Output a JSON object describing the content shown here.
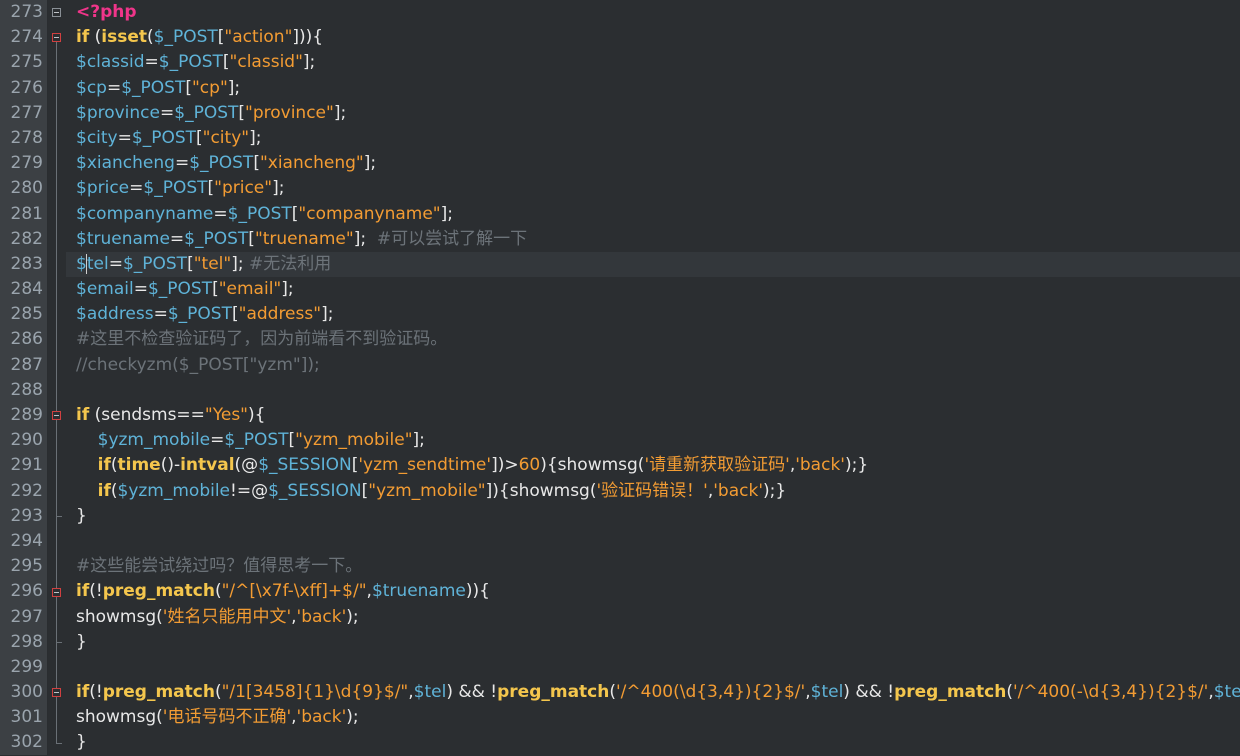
{
  "editor": {
    "line_numbers": [
      "273",
      "274",
      "275",
      "276",
      "277",
      "278",
      "279",
      "280",
      "281",
      "282",
      "283",
      "284",
      "285",
      "286",
      "287",
      "288",
      "289",
      "290",
      "291",
      "292",
      "293",
      "294",
      "295",
      "296",
      "297",
      "298",
      "299",
      "300",
      "301",
      "302"
    ],
    "lines": [
      [
        [
          "php",
          "<?php"
        ]
      ],
      [
        [
          "kw",
          "if"
        ],
        [
          "op",
          " ("
        ],
        [
          "fn",
          "isset"
        ],
        [
          "op",
          "("
        ],
        [
          "var",
          "$_POST"
        ],
        [
          "op",
          "["
        ],
        [
          "str",
          "\"action\""
        ],
        [
          "op",
          "])){"
        ]
      ],
      [
        [
          "var",
          "$classid"
        ],
        [
          "op",
          "="
        ],
        [
          "var",
          "$_POST"
        ],
        [
          "op",
          "["
        ],
        [
          "str",
          "\"classid\""
        ],
        [
          "op",
          "];"
        ]
      ],
      [
        [
          "var",
          "$cp"
        ],
        [
          "op",
          "="
        ],
        [
          "var",
          "$_POST"
        ],
        [
          "op",
          "["
        ],
        [
          "str",
          "\"cp\""
        ],
        [
          "op",
          "];"
        ]
      ],
      [
        [
          "var",
          "$province"
        ],
        [
          "op",
          "="
        ],
        [
          "var",
          "$_POST"
        ],
        [
          "op",
          "["
        ],
        [
          "str",
          "\"province\""
        ],
        [
          "op",
          "];"
        ]
      ],
      [
        [
          "var",
          "$city"
        ],
        [
          "op",
          "="
        ],
        [
          "var",
          "$_POST"
        ],
        [
          "op",
          "["
        ],
        [
          "str",
          "\"city\""
        ],
        [
          "op",
          "];"
        ]
      ],
      [
        [
          "var",
          "$xiancheng"
        ],
        [
          "op",
          "="
        ],
        [
          "var",
          "$_POST"
        ],
        [
          "op",
          "["
        ],
        [
          "str",
          "\"xiancheng\""
        ],
        [
          "op",
          "];"
        ]
      ],
      [
        [
          "var",
          "$price"
        ],
        [
          "op",
          "="
        ],
        [
          "var",
          "$_POST"
        ],
        [
          "op",
          "["
        ],
        [
          "str",
          "\"price\""
        ],
        [
          "op",
          "];"
        ]
      ],
      [
        [
          "var",
          "$companyname"
        ],
        [
          "op",
          "="
        ],
        [
          "var",
          "$_POST"
        ],
        [
          "op",
          "["
        ],
        [
          "str",
          "\"companyname\""
        ],
        [
          "op",
          "];"
        ]
      ],
      [
        [
          "var",
          "$truename"
        ],
        [
          "op",
          "="
        ],
        [
          "var",
          "$_POST"
        ],
        [
          "op",
          "["
        ],
        [
          "str",
          "\"truename\""
        ],
        [
          "op",
          "];  "
        ],
        [
          "cmt",
          "#可以尝试了解一下"
        ]
      ],
      [
        [
          "var",
          "$tel"
        ],
        [
          "op",
          "="
        ],
        [
          "var",
          "$_POST"
        ],
        [
          "op",
          "["
        ],
        [
          "str",
          "\"tel\""
        ],
        [
          "op",
          "]; "
        ],
        [
          "cmt",
          "#无法利用"
        ]
      ],
      [
        [
          "var",
          "$email"
        ],
        [
          "op",
          "="
        ],
        [
          "var",
          "$_POST"
        ],
        [
          "op",
          "["
        ],
        [
          "str",
          "\"email\""
        ],
        [
          "op",
          "];"
        ]
      ],
      [
        [
          "var",
          "$address"
        ],
        [
          "op",
          "="
        ],
        [
          "var",
          "$_POST"
        ],
        [
          "op",
          "["
        ],
        [
          "str",
          "\"address\""
        ],
        [
          "op",
          "];"
        ]
      ],
      [
        [
          "cmt",
          "#这里不检查验证码了，因为前端看不到验证码。"
        ]
      ],
      [
        [
          "cmt",
          "//checkyzm($_POST[\"yzm\"]);"
        ]
      ],
      [],
      [
        [
          "kw",
          "if"
        ],
        [
          "op",
          " (sendsms=="
        ],
        [
          "str",
          "\"Yes\""
        ],
        [
          "op",
          "){"
        ]
      ],
      [
        [
          "op",
          "    "
        ],
        [
          "var",
          "$yzm_mobile"
        ],
        [
          "op",
          "="
        ],
        [
          "var",
          "$_POST"
        ],
        [
          "op",
          "["
        ],
        [
          "str",
          "\"yzm_mobile\""
        ],
        [
          "op",
          "];"
        ]
      ],
      [
        [
          "op",
          "    "
        ],
        [
          "kw",
          "if"
        ],
        [
          "op",
          "("
        ],
        [
          "fn",
          "time"
        ],
        [
          "op",
          "()-"
        ],
        [
          "fn",
          "intval"
        ],
        [
          "op",
          "(@"
        ],
        [
          "var",
          "$_SESSION"
        ],
        [
          "op",
          "["
        ],
        [
          "str",
          "'yzm_sendtime'"
        ],
        [
          "op",
          "])>"
        ],
        [
          "num",
          "60"
        ],
        [
          "op",
          "){showmsg("
        ],
        [
          "str",
          "'请重新获取验证码'"
        ],
        [
          "op",
          ","
        ],
        [
          "str",
          "'back'"
        ],
        [
          "op",
          ");}"
        ]
      ],
      [
        [
          "op",
          "    "
        ],
        [
          "kw",
          "if"
        ],
        [
          "op",
          "("
        ],
        [
          "var",
          "$yzm_mobile"
        ],
        [
          "op",
          "!=@"
        ],
        [
          "var",
          "$_SESSION"
        ],
        [
          "op",
          "["
        ],
        [
          "str",
          "\"yzm_mobile\""
        ],
        [
          "op",
          "]){showmsg("
        ],
        [
          "str",
          "'验证码错误！'"
        ],
        [
          "op",
          ","
        ],
        [
          "str",
          "'back'"
        ],
        [
          "op",
          ");}"
        ]
      ],
      [
        [
          "op",
          "}"
        ]
      ],
      [],
      [
        [
          "cmt",
          "#这些能尝试绕过吗？值得思考一下。"
        ]
      ],
      [
        [
          "kw",
          "if"
        ],
        [
          "op",
          "(!"
        ],
        [
          "fn",
          "preg_match"
        ],
        [
          "op",
          "("
        ],
        [
          "str",
          "\"/^[\\x7f-\\xff]+$/\""
        ],
        [
          "op",
          ","
        ],
        [
          "var",
          "$truename"
        ],
        [
          "op",
          ")){"
        ]
      ],
      [
        [
          "op",
          "showmsg("
        ],
        [
          "str",
          "'姓名只能用中文'"
        ],
        [
          "op",
          ","
        ],
        [
          "str",
          "'back'"
        ],
        [
          "op",
          ");"
        ]
      ],
      [
        [
          "op",
          "}"
        ]
      ],
      [],
      [
        [
          "kw",
          "if"
        ],
        [
          "op",
          "(!"
        ],
        [
          "fn",
          "preg_match"
        ],
        [
          "op",
          "("
        ],
        [
          "str",
          "\"/1[3458]{1}\\d{9}$/\""
        ],
        [
          "op",
          ","
        ],
        [
          "var",
          "$tel"
        ],
        [
          "op",
          ") && !"
        ],
        [
          "fn",
          "preg_match"
        ],
        [
          "op",
          "("
        ],
        [
          "str",
          "'/^400(\\d{3,4}){2}$/'"
        ],
        [
          "op",
          ","
        ],
        [
          "var",
          "$tel"
        ],
        [
          "op",
          ") && !"
        ],
        [
          "fn",
          "preg_match"
        ],
        [
          "op",
          "("
        ],
        [
          "str",
          "'/^400(-\\d{3,4}){2}$/'"
        ],
        [
          "op",
          ","
        ],
        [
          "var",
          "$tel"
        ],
        [
          "op",
          ") &"
        ]
      ],
      [
        [
          "op",
          "showmsg("
        ],
        [
          "str",
          "'电话号码不正确'"
        ],
        [
          "op",
          ","
        ],
        [
          "str",
          "'back'"
        ],
        [
          "op",
          ");"
        ]
      ],
      [
        [
          "op",
          "}"
        ]
      ]
    ]
  }
}
